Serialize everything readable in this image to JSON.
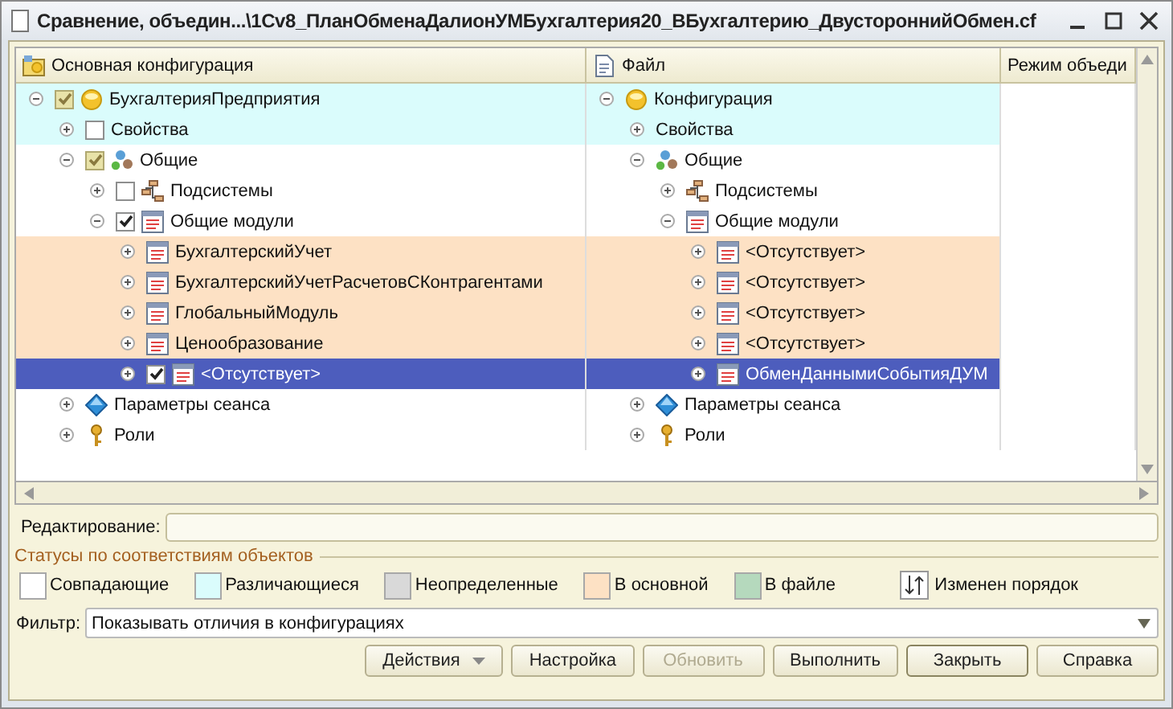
{
  "window": {
    "title": "Сравнение, объедин...\\1Cv8_ПланОбменаДалионУМБухгалтерия20_ВБухгалтерию_ДвустороннийОбмен.cf"
  },
  "columns": [
    {
      "label": "Основная конфигурация",
      "kind": "main"
    },
    {
      "label": "Файл",
      "kind": "file"
    },
    {
      "label": "Режим объеди",
      "kind": "plain"
    }
  ],
  "tree": [
    {
      "name": "БухгалтерияПредприятия",
      "file": "Конфигурация",
      "kind": "config",
      "checked": true,
      "greyed": true,
      "expanded": true,
      "color": "#dafcfc",
      "selected": false,
      "children": [
        {
          "name": "Свойства",
          "file": "Свойства",
          "kind": "properties",
          "checked": false,
          "expanded": false,
          "color": "#dafcfc",
          "selected": false
        },
        {
          "name": "Общие",
          "file": "Общие",
          "kind": "common",
          "checked": true,
          "greyed": true,
          "expanded": true,
          "color": "#ffffff",
          "selected": false,
          "children": [
            {
              "name": "Подсистемы",
              "file": "Подсистемы",
              "kind": "subsystems",
              "checked": false,
              "expanded": false,
              "color": "#ffffff",
              "selected": false
            },
            {
              "name": "Общие модули",
              "file": "Общие модули",
              "kind": "module",
              "checked": true,
              "greyed": false,
              "expanded": true,
              "color": "#ffffff",
              "selected": false,
              "children": [
                {
                  "name": "БухгалтерскийУчет",
                  "file": "<Отсутствует>",
                  "kind": "module",
                  "expanded": false,
                  "color": "#fde1c4",
                  "selected": false
                },
                {
                  "name": "БухгалтерскийУчетРасчетовСКонтрагентами",
                  "file": "<Отсутствует>",
                  "kind": "module",
                  "expanded": false,
                  "color": "#fde1c4",
                  "selected": false
                },
                {
                  "name": "ГлобальныйМодуль",
                  "file": "<Отсутствует>",
                  "kind": "module",
                  "expanded": false,
                  "color": "#fde1c4",
                  "selected": false
                },
                {
                  "name": "Ценообразование",
                  "file": "<Отсутствует>",
                  "kind": "module",
                  "expanded": false,
                  "color": "#fde1c4",
                  "selected": false
                },
                {
                  "name": "<Отсутствует>",
                  "file": "ОбменДаннымиСобытияДУМ",
                  "kind": "module",
                  "checked": true,
                  "greyed": false,
                  "expanded": false,
                  "selected": true
                }
              ]
            }
          ]
        },
        {
          "name": "Параметры сеанса",
          "file": "Параметры сеанса",
          "kind": "session",
          "expanded": false,
          "color": "#ffffff",
          "selected": false
        },
        {
          "name": "Роли",
          "file": "Роли",
          "kind": "role",
          "expanded": false,
          "color": "#ffffff",
          "selected": false
        }
      ]
    }
  ],
  "editing": {
    "label": "Редактирование:"
  },
  "legend": {
    "title": "Статусы по соответствиям объектов",
    "items": [
      {
        "label": "Совпадающие",
        "kind": "swatch",
        "color": "#ffffff"
      },
      {
        "label": "Различающиеся",
        "kind": "swatch",
        "color": "#dafcfc"
      },
      {
        "label": "Неопределенные",
        "kind": "swatch",
        "color": "#d9d9d9"
      },
      {
        "label": "В основной",
        "kind": "swatch",
        "color": "#fde1c4"
      },
      {
        "label": "В файле",
        "kind": "swatch",
        "color": "#b5d9bd"
      },
      {
        "label": "Изменен порядок",
        "kind": "order"
      }
    ]
  },
  "filter": {
    "label": "Фильтр:",
    "value": "Показывать отличия в конфигурациях"
  },
  "buttons": [
    {
      "label": "Действия",
      "dropdown": true,
      "disabled": false
    },
    {
      "label": "Настройка",
      "disabled": false
    },
    {
      "label": "Обновить",
      "disabled": true
    },
    {
      "label": "Выполнить",
      "disabled": false
    },
    {
      "label": "Закрыть",
      "disabled": false,
      "default": true
    },
    {
      "label": "Справка",
      "disabled": false
    }
  ]
}
